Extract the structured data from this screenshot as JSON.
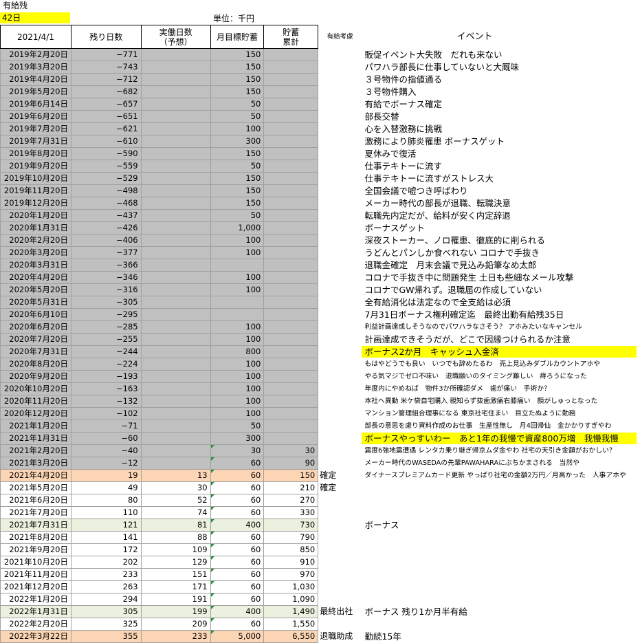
{
  "sheet": {
    "title": "有給残",
    "leave_days": "42日",
    "unit": "単位：千円"
  },
  "headers": {
    "base_date": "2021/4/1",
    "remaining": "残り日数",
    "workdays": "実働日数\n（予想）",
    "target": "月目標貯蓄",
    "cumulative": "貯蓄\n累計",
    "leave_note": "有給考慮",
    "event": "イベント"
  },
  "rows": [
    {
      "date": "2019年2月20日",
      "remaining": "−771",
      "workdays": "",
      "target": "150",
      "cumulative": "",
      "note": "",
      "event": "販促イベント大失敗　だれも来ない",
      "style": "gray"
    },
    {
      "date": "2019年3月20日",
      "remaining": "−743",
      "workdays": "",
      "target": "150",
      "cumulative": "",
      "note": "",
      "event": "パワハラ部長に仕事していないと大厩味",
      "style": "gray"
    },
    {
      "date": "2019年4月20日",
      "remaining": "−712",
      "workdays": "",
      "target": "150",
      "cumulative": "",
      "note": "",
      "event": "３号物件の指値通る",
      "style": "gray"
    },
    {
      "date": "2019年5月20日",
      "remaining": "−682",
      "workdays": "",
      "target": "150",
      "cumulative": "",
      "note": "",
      "event": "３号物件購入",
      "style": "gray"
    },
    {
      "date": "2019年6月14日",
      "remaining": "−657",
      "workdays": "",
      "target": "50",
      "cumulative": "",
      "note": "",
      "event": "有給でボーナス確定",
      "style": "gray"
    },
    {
      "date": "2019年6月20日",
      "remaining": "−651",
      "workdays": "",
      "target": "50",
      "cumulative": "",
      "note": "",
      "event": "部長交替",
      "style": "gray"
    },
    {
      "date": "2019年7月20日",
      "remaining": "−621",
      "workdays": "",
      "target": "100",
      "cumulative": "",
      "note": "",
      "event": "心を入替激務に挑戦",
      "style": "gray"
    },
    {
      "date": "2019年7月31日",
      "remaining": "−610",
      "workdays": "",
      "target": "300",
      "cumulative": "",
      "note": "",
      "event": "激務により肺炎罹患 ボーナスゲット",
      "style": "gray"
    },
    {
      "date": "2019年8月20日",
      "remaining": "−590",
      "workdays": "",
      "target": "150",
      "cumulative": "",
      "note": "",
      "event": "夏休みで復活",
      "style": "gray"
    },
    {
      "date": "2019年9月20日",
      "remaining": "−559",
      "workdays": "",
      "target": "50",
      "cumulative": "",
      "note": "",
      "event": "仕事テキトーに流す",
      "style": "gray"
    },
    {
      "date": "2019年10月20日",
      "remaining": "−529",
      "workdays": "",
      "target": "150",
      "cumulative": "",
      "note": "",
      "event": "仕事テキトーに流すがストレス大",
      "style": "gray"
    },
    {
      "date": "2019年11月20日",
      "remaining": "−498",
      "workdays": "",
      "target": "150",
      "cumulative": "",
      "note": "",
      "event": "全国会議で嘘つき呼ばわり",
      "style": "gray"
    },
    {
      "date": "2019年12月20日",
      "remaining": "−468",
      "workdays": "",
      "target": "150",
      "cumulative": "",
      "note": "",
      "event": "メーカー時代の部長が退職、転職決意",
      "style": "gray"
    },
    {
      "date": "2020年1月20日",
      "remaining": "−437",
      "workdays": "",
      "target": "50",
      "cumulative": "",
      "note": "",
      "event": "転職先内定だが、給料が安く内定辞退",
      "style": "gray"
    },
    {
      "date": "2020年1月31日",
      "remaining": "−426",
      "workdays": "",
      "target": "1,000",
      "cumulative": "",
      "note": "",
      "event": "ボーナスゲット",
      "style": "gray"
    },
    {
      "date": "2020年2月20日",
      "remaining": "−406",
      "workdays": "",
      "target": "100",
      "cumulative": "",
      "note": "",
      "event": "深夜ストーカー、ノロ罹患、徹底的に削られる",
      "style": "gray"
    },
    {
      "date": "2020年3月20日",
      "remaining": "−377",
      "workdays": "",
      "target": "100",
      "cumulative": "",
      "note": "",
      "event": "うどんとパンしか食べれない コロナで手抜き",
      "style": "gray"
    },
    {
      "date": "2020年3月31日",
      "remaining": "−366",
      "workdays": "",
      "target": "",
      "cumulative": "",
      "note": "",
      "event": "退職金確定　月末会議で見込み鉛筆なめ太郎",
      "style": "gray"
    },
    {
      "date": "2020年4月20日",
      "remaining": "−346",
      "workdays": "",
      "target": "100",
      "cumulative": "",
      "note": "",
      "event": "コロナで手抜き中に問題発生 土日も些細なメール攻撃",
      "style": "gray"
    },
    {
      "date": "2020年5月20日",
      "remaining": "−316",
      "workdays": "",
      "target": "100",
      "cumulative": "",
      "note": "",
      "event": "コロナでGW帰れず。退職届の作成していない",
      "style": "gray"
    },
    {
      "date": "2020年5月31日",
      "remaining": "−305",
      "workdays": "",
      "target": "",
      "cumulative": "",
      "note": "",
      "event": "全有給消化は法定なので全支給は必須",
      "style": "gray"
    },
    {
      "date": "2020年6月10日",
      "remaining": "−295",
      "workdays": "",
      "target": "",
      "cumulative": "",
      "note": "",
      "event": "7月31日ボーナス権利確定迄　最終出勤有給残35日",
      "style": "gray"
    },
    {
      "date": "2020年6月20日",
      "remaining": "−285",
      "workdays": "",
      "target": "100",
      "cumulative": "",
      "note": "",
      "event": "利益計画達成しそうなのでパワハラなさそう？ アホみたいなキャンセル",
      "style": "gray",
      "small": true
    },
    {
      "date": "2020年7月20日",
      "remaining": "−255",
      "workdays": "",
      "target": "100",
      "cumulative": "",
      "note": "",
      "event": "計画達成できそうだが、どこで因縁つけられるか注意",
      "style": "gray"
    },
    {
      "date": "2020年7月31日",
      "remaining": "−244",
      "workdays": "",
      "target": "800",
      "cumulative": "",
      "note": "",
      "event": "ボーナス2か月　キャッシュ入金済",
      "style": "gray",
      "highlight": true
    },
    {
      "date": "2020年8月20日",
      "remaining": "−224",
      "workdays": "",
      "target": "100",
      "cumulative": "",
      "note": "",
      "event": "もはやどうでも良い　いつでも辞めたるわ　売上見込みダブルカウントアホや",
      "style": "gray",
      "small": true
    },
    {
      "date": "2020年9月20日",
      "remaining": "−193",
      "workdays": "",
      "target": "100",
      "cumulative": "",
      "note": "",
      "event": "やる気マジでゼロ不味い　退職願いのタイミング難しい　痔ろうになった",
      "style": "gray",
      "small": true
    },
    {
      "date": "2020年10月20日",
      "remaining": "−163",
      "workdays": "",
      "target": "100",
      "cumulative": "",
      "note": "",
      "event": "年度内にやめねば　物件3か所確認ダメ　歯が痛い　手術か？",
      "style": "gray",
      "small": true
    },
    {
      "date": "2020年11月20日",
      "remaining": "−132",
      "workdays": "",
      "target": "100",
      "cumulative": "",
      "note": "",
      "event": "本社へ異動 米ケ袋自宅購入 親知らず抜歯激痛右膝痛い　顔がしゅっとなった",
      "style": "gray",
      "small": true
    },
    {
      "date": "2020年12月20日",
      "remaining": "−102",
      "workdays": "",
      "target": "100",
      "cumulative": "",
      "note": "",
      "event": "マンション管理組合理事になる 東京社宅住まい　目立たぬように勤務",
      "style": "gray",
      "small": true
    },
    {
      "date": "2021年1月20日",
      "remaining": "−71",
      "workdays": "",
      "target": "50",
      "cumulative": "",
      "note": "",
      "event": "部長の意思を慮り資料作成のお仕事　生産性無し　月4回帰仙　金かかりすぎやわ",
      "style": "gray",
      "small": true
    },
    {
      "date": "2021年1月31日",
      "remaining": "−60",
      "workdays": "",
      "target": "300",
      "cumulative": "",
      "note": "",
      "event": "ボーナスやっすいわー　あと1年の我慢で資産800万増　我慢我慢",
      "style": "gray",
      "highlight": true
    },
    {
      "date": "2021年2月20日",
      "remaining": "−40",
      "workdays": "",
      "target": "30",
      "cumulative": "30",
      "note": "",
      "event": "震度6強地震遭遇 レンタカ乗り継ぎ帰京ムダ金やわ 社宅の天引き金額がおかしい？",
      "style": "gray",
      "small": true
    },
    {
      "date": "2021年3月20日",
      "remaining": "−12",
      "workdays": "",
      "target": "60",
      "cumulative": "90",
      "note": "",
      "event": "メーカー時代のWASEDAの先輩PAWAHARAにぶちかまされる　当然や",
      "style": "gray",
      "small": true
    },
    {
      "date": "2021年4月20日",
      "remaining": "19",
      "workdays": "13",
      "target": "60",
      "cumulative": "150",
      "note": "確定",
      "event": "ダイナースプレミアムカード更新 やっぱり社宅の金額2万円／月高かった　人事アホや",
      "style": "peach",
      "small": true
    },
    {
      "date": "2021年5月20日",
      "remaining": "49",
      "workdays": "30",
      "target": "60",
      "cumulative": "210",
      "note": "確定",
      "event": "",
      "style": "white"
    },
    {
      "date": "2021年6月20日",
      "remaining": "80",
      "workdays": "52",
      "target": "60",
      "cumulative": "270",
      "note": "",
      "event": "",
      "style": "white"
    },
    {
      "date": "2021年7月20日",
      "remaining": "110",
      "workdays": "74",
      "target": "60",
      "cumulative": "330",
      "note": "",
      "event": "",
      "style": "white"
    },
    {
      "date": "2021年7月31日",
      "remaining": "121",
      "workdays": "81",
      "target": "400",
      "cumulative": "730",
      "note": "",
      "event": "ボーナス",
      "style": "lgreen"
    },
    {
      "date": "2021年8月20日",
      "remaining": "141",
      "workdays": "88",
      "target": "60",
      "cumulative": "790",
      "note": "",
      "event": "",
      "style": "white"
    },
    {
      "date": "2021年9月20日",
      "remaining": "172",
      "workdays": "109",
      "target": "60",
      "cumulative": "850",
      "note": "",
      "event": "",
      "style": "white"
    },
    {
      "date": "2021年10月20日",
      "remaining": "202",
      "workdays": "129",
      "target": "60",
      "cumulative": "910",
      "note": "",
      "event": "",
      "style": "white"
    },
    {
      "date": "2021年11月20日",
      "remaining": "233",
      "workdays": "151",
      "target": "60",
      "cumulative": "970",
      "note": "",
      "event": "",
      "style": "white"
    },
    {
      "date": "2021年12月20日",
      "remaining": "263",
      "workdays": "171",
      "target": "60",
      "cumulative": "1,030",
      "note": "",
      "event": "",
      "style": "white"
    },
    {
      "date": "2022年1月20日",
      "remaining": "294",
      "workdays": "191",
      "target": "60",
      "cumulative": "1,090",
      "note": "",
      "event": "",
      "style": "white"
    },
    {
      "date": "2022年1月31日",
      "remaining": "305",
      "workdays": "199",
      "target": "400",
      "cumulative": "1,490",
      "note": "最終出社",
      "event": "ボーナス 残り1か月半有給",
      "style": "lgreen"
    },
    {
      "date": "2022年2月20日",
      "remaining": "325",
      "workdays": "209",
      "target": "60",
      "cumulative": "1,550",
      "note": "",
      "event": "",
      "style": "white"
    },
    {
      "date": "2022年3月22日",
      "remaining": "355",
      "workdays": "233",
      "target": "5,000",
      "cumulative": "6,550",
      "note": "退職助成",
      "event": "勤続15年",
      "style": "peach"
    }
  ]
}
